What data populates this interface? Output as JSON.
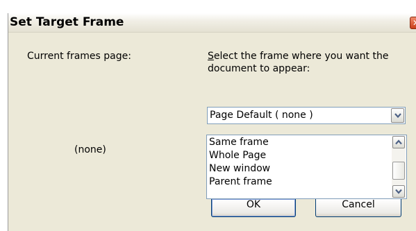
{
  "dialog": {
    "title": "Set Target Frame",
    "close_glyph": "✕"
  },
  "labels": {
    "current_frames": "Current frames page:",
    "select_prompt": "Select the frame where you want the document to appear:",
    "select_prompt_underline": "S",
    "none_text": "(none)"
  },
  "combo": {
    "value": "Page Default ( none )"
  },
  "list": {
    "items": [
      "Same frame",
      "Whole Page",
      "New window",
      "Parent frame"
    ]
  },
  "buttons": {
    "ok_label": "OK",
    "cancel_label": "Cancel"
  },
  "icons": {
    "combo_arrow": "chevron-down-icon",
    "scroll_up": "chevron-up-icon",
    "scroll_down": "chevron-down-icon",
    "close": "close-icon"
  }
}
